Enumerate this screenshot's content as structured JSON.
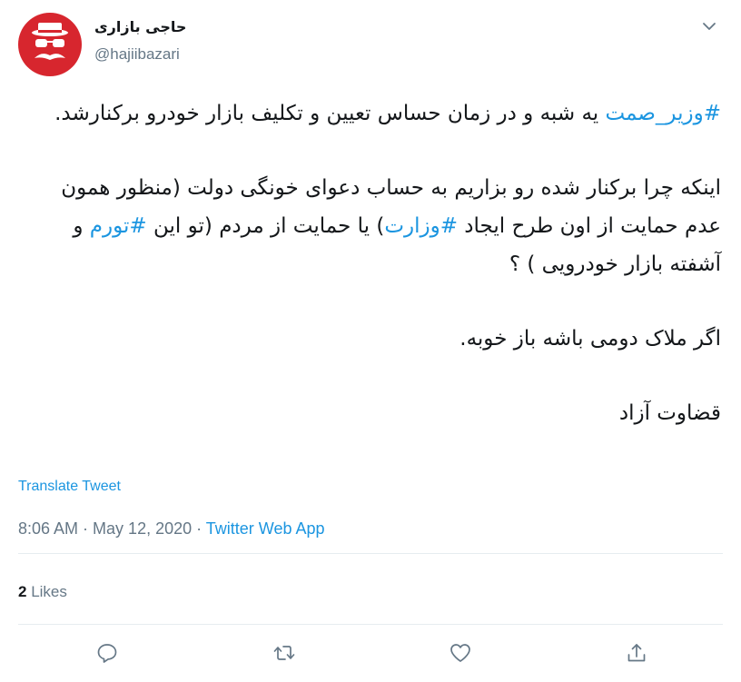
{
  "user": {
    "name": "حاجی بازاری",
    "handle": "@hajiibazari"
  },
  "tweet": {
    "para1": {
      "hashtag": "#وزیر_صمت",
      "text": " یه شبه و در زمان حساس تعیین و تکلیف بازار خودرو برکنارشد."
    },
    "para2": {
      "text_a": "اینکه چرا برکنار شده رو بزاریم به حساب دعوای خونگی دولت (منظور همون عدم حمایت از اون طرح ایجاد ",
      "hashtag_a": "#وزارت",
      "text_b": ")  یا حمایت از مردم (تو این ",
      "hashtag_b": "#تورم",
      "text_c": " و آشفته بازار خودرویی ) ؟"
    },
    "para3": "اگر ملاک دومی باشه باز خوبه.",
    "para4": "قضاوت آزاد"
  },
  "translate_label": "Translate Tweet",
  "meta": {
    "time": "8:06 AM",
    "separator_1": " · ",
    "date": "May 12, 2020",
    "separator_2": " · ",
    "source": "Twitter Web App"
  },
  "likes": {
    "count": "2",
    "label": " Likes"
  },
  "icons": {
    "reply": "reply-icon",
    "retweet": "retweet-icon",
    "like": "heart-icon",
    "share": "share-icon",
    "more": "chevron-down-icon"
  },
  "colors": {
    "text": "#14171a",
    "secondary": "#657786",
    "link": "#1b95e0",
    "divider": "#e6ecf0",
    "avatar_red": "#d7262e"
  }
}
